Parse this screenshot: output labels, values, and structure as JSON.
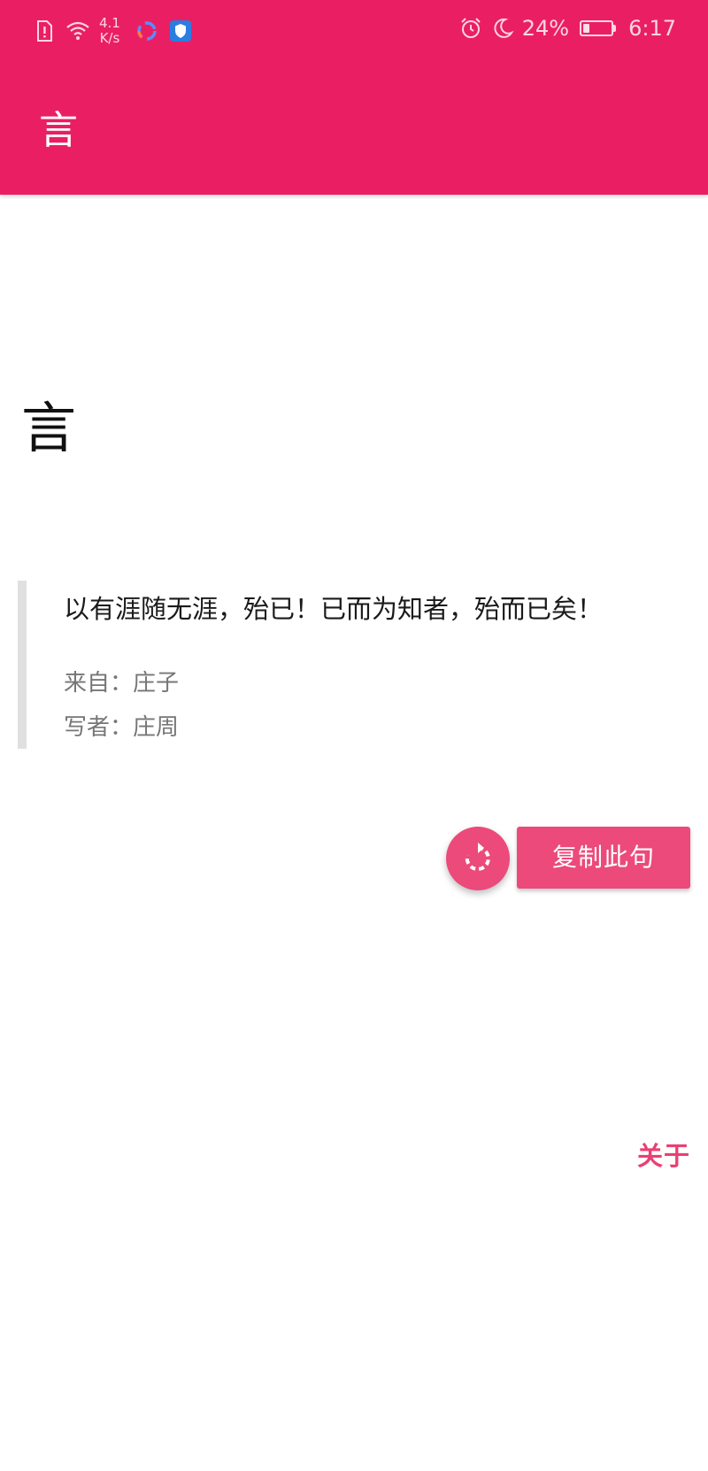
{
  "status_bar": {
    "net_speed_value": "4.1",
    "net_speed_unit": "K/s",
    "battery_percent": "24%",
    "battery_level": 0.24,
    "time": "6:17",
    "icons": [
      "sim-alert-icon",
      "wifi-icon",
      "app-ring-icon",
      "shield-app-icon",
      "alarm-icon",
      "moon-icon",
      "battery-icon"
    ]
  },
  "toolbar": {
    "title": "言"
  },
  "main": {
    "heading": "言",
    "quote": {
      "text": "以有涯随无涯，殆已！已而为知者，殆而已矣！",
      "source": "来自：庄子",
      "author": "写者：庄周"
    },
    "refresh_icon": "refresh-icon",
    "copy_label": "复制此句",
    "about_label": "关于"
  },
  "colors": {
    "primary": "#ea1f63",
    "accent": "#ec4a7a",
    "link": "#ea3f72"
  }
}
